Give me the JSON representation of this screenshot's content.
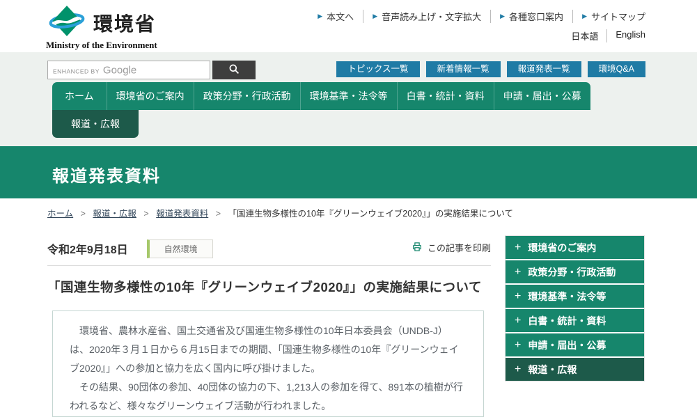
{
  "colors": {
    "nav_green": "#16866c",
    "active_dark_green": "#1d5a4a",
    "button_blue": "#1f7ba5",
    "badge_green": "#a6c86a",
    "band_gray": "#edf1ee"
  },
  "header": {
    "logo_kanji": "環境省",
    "logo_subtitle": "Ministry of the Environment",
    "arrow_icon": "▶",
    "utility_links": [
      "本文へ",
      "音声読み上げ・文字拡大",
      "各種窓口案内",
      "サイトマップ"
    ],
    "lang_links": [
      "日本語",
      "English"
    ]
  },
  "search": {
    "placeholder_prefix": "ENHANCED BY",
    "placeholder_brand": "Google"
  },
  "quick_buttons": [
    "トピックス一覧",
    "新着情報一覧",
    "報道発表一覧",
    "環境Q&A"
  ],
  "nav": {
    "items": [
      "ホーム",
      "環境省のご案内",
      "政策分野・行政活動",
      "環境基準・法令等",
      "白書・統計・資料",
      "申請・届出・公募"
    ],
    "active_item": "報道・広報"
  },
  "page": {
    "title": "報道発表資料"
  },
  "breadcrumb": {
    "separator": ">",
    "links": [
      "ホーム",
      "報道・広報",
      "報道発表資料"
    ],
    "current": "「国連生物多様性の10年『グリーンウェイブ2020』」の実施結果について"
  },
  "article": {
    "date": "令和2年9月18日",
    "category": "自然環境",
    "print_label": "この記事を印刷",
    "title": "「国連生物多様性の10年『グリーンウェイブ2020』」の実施結果について",
    "paragraphs": [
      "　環境省、農林水産省、国土交通省及び国連生物多様性の10年日本委員会（UNDB-J）は、2020年３月１日から６月15日までの期間、「国連生物多様性の10年『グリーンウェイブ2020』」への参加と協力を広く国内に呼び掛けました。",
      "　その結果、90団体の参加、40団体の協力の下、1,213人の参加を得て、891本の植樹が行われるなど、様々なグリーンウェイブ活動が行われました。"
    ]
  },
  "sidebar": {
    "plus_icon": "+",
    "items": [
      {
        "label": "環境省のご案内",
        "active": false
      },
      {
        "label": "政策分野・行政活動",
        "active": false
      },
      {
        "label": "環境基準・法令等",
        "active": false
      },
      {
        "label": "白書・統計・資料",
        "active": false
      },
      {
        "label": "申請・届出・公募",
        "active": false
      },
      {
        "label": "報道・広報",
        "active": true
      }
    ]
  }
}
